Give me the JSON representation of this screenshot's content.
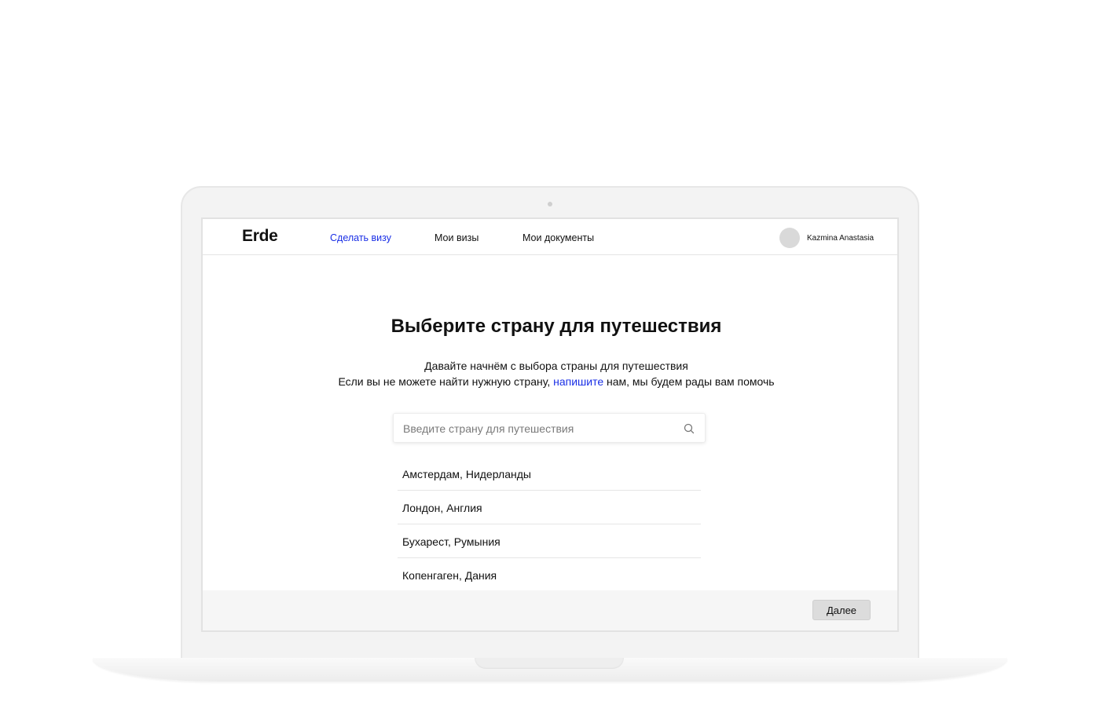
{
  "app": {
    "logo": "Erde"
  },
  "nav": {
    "items": [
      {
        "label": "Сделать визу",
        "active": true
      },
      {
        "label": "Мои визы",
        "active": false
      },
      {
        "label": "Мои документы",
        "active": false
      }
    ]
  },
  "user": {
    "name": "Kazmina Anastasia"
  },
  "main": {
    "title": "Выберите страну для путешествия",
    "subtitle_line1": "Давайте начнём с выбора страны для путешествия",
    "subtitle_line2_before": "Если вы не можете найти нужную страну, ",
    "subtitle_link": "напишите",
    "subtitle_line2_after": " нам, мы будем рады вам помочь"
  },
  "search": {
    "placeholder": "Введите страну для путешествия",
    "value": ""
  },
  "destinations": [
    "Амстердам, Нидерланды",
    "Лондон, Англия",
    "Бухарест, Румыния",
    "Копенгаген, Дания"
  ],
  "footer": {
    "next_label": "Далее"
  },
  "colors": {
    "accent": "#1a2fe6",
    "footer_bg": "#f6f6f6"
  }
}
